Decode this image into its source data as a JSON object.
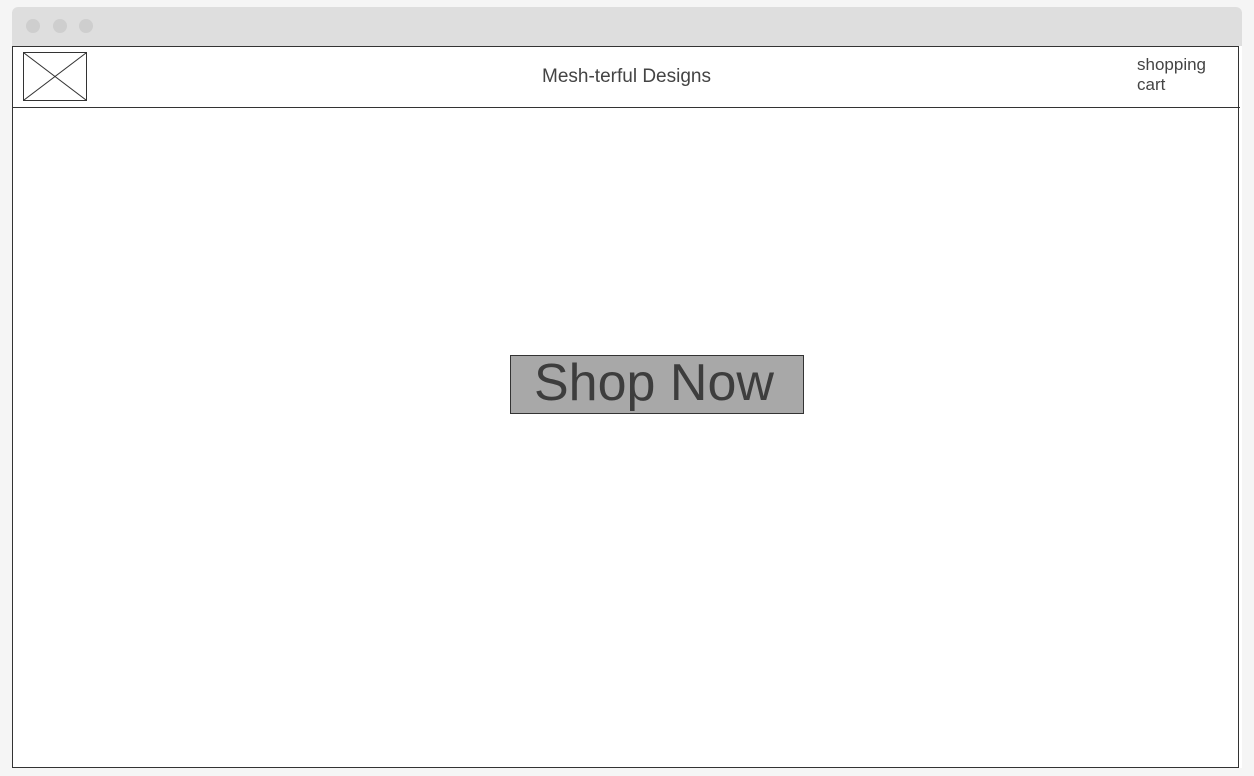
{
  "window": {
    "controls": [
      "close-dot",
      "minimize-dot",
      "maximize-dot"
    ]
  },
  "header": {
    "logo_icon": "image-placeholder-icon",
    "title": "Mesh-terful Designs",
    "cart_label_line1": "shopping",
    "cart_label_line2": "cart"
  },
  "main": {
    "cta_label": "Shop Now"
  },
  "colors": {
    "button_fill": "#a8a8a8",
    "border": "#333333",
    "text": "#444444",
    "titlebar": "#dedede"
  }
}
